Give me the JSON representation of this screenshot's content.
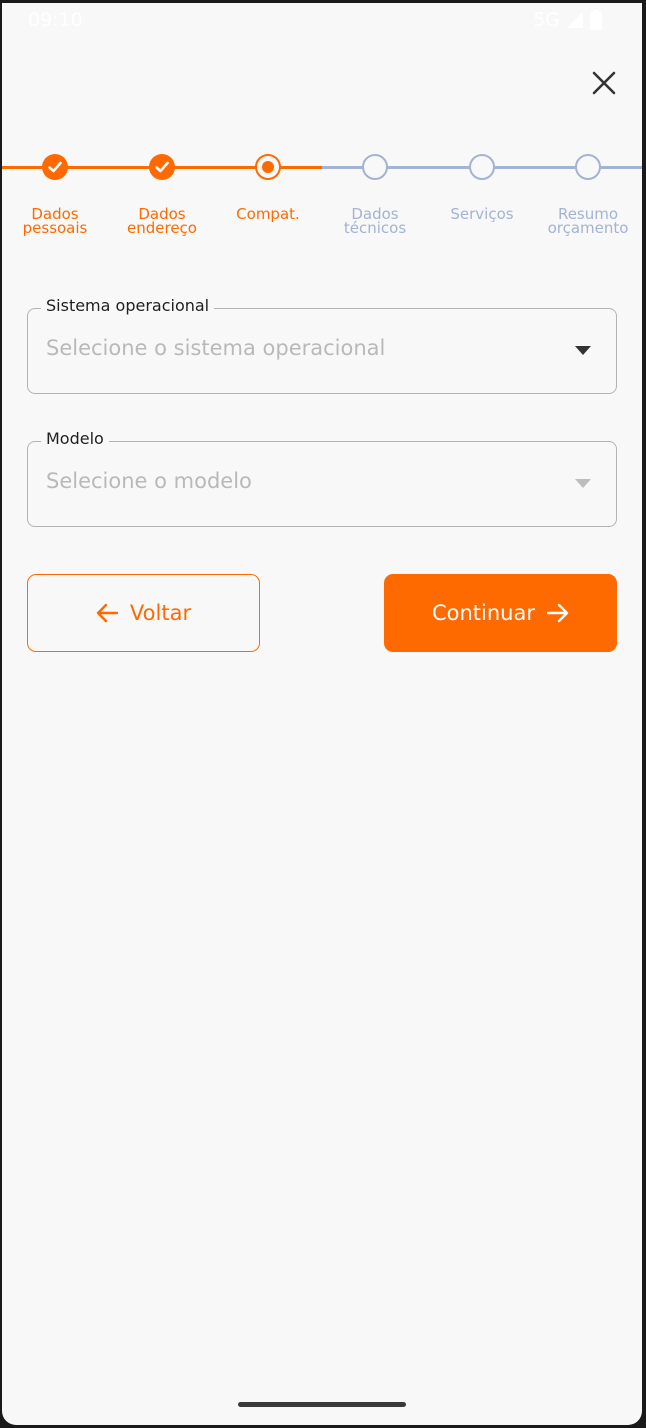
{
  "status_bar": {
    "time": "09:10",
    "network": "5G"
  },
  "stepper": {
    "steps": [
      {
        "label_line1": "Dados",
        "label_line2": "pessoais",
        "state": "done"
      },
      {
        "label_line1": "Dados",
        "label_line2": "endereço",
        "state": "done"
      },
      {
        "label_line1": "Compat.",
        "label_line2": "",
        "state": "current"
      },
      {
        "label_line1": "Dados",
        "label_line2": "técnicos",
        "state": "todo"
      },
      {
        "label_line1": "Serviços",
        "label_line2": "",
        "state": "todo"
      },
      {
        "label_line1": "Resumo",
        "label_line2": "orçamento",
        "state": "todo"
      }
    ]
  },
  "form": {
    "os_field": {
      "label": "Sistema operacional",
      "placeholder": "Selecione o sistema operacional"
    },
    "model_field": {
      "label": "Modelo",
      "placeholder": "Selecione o modelo"
    }
  },
  "actions": {
    "back_label": "Voltar",
    "continue_label": "Continuar"
  },
  "colors": {
    "accent": "#ff6a00",
    "inactive": "#a3b3d3",
    "background": "#f8f8f8"
  },
  "icons": {
    "close": "close-icon",
    "dropdown": "chevron-down-icon",
    "back": "arrow-left-icon",
    "next": "arrow-right-icon",
    "check": "check-icon"
  }
}
